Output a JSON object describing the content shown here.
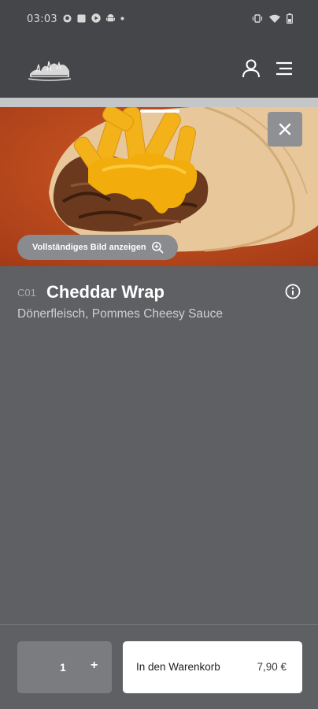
{
  "status_bar": {
    "time": "03:03",
    "left_icons": [
      "github-icon",
      "square-icon",
      "play-icon",
      "android-icon",
      "dot-icon"
    ],
    "right_icons": [
      "vibrate-icon",
      "wifi-icon",
      "battery-icon"
    ]
  },
  "header": {
    "logo": "restaurant-logo",
    "icons": [
      "user-icon",
      "menu-icon"
    ]
  },
  "hero": {
    "full_image_label": "Vollständiges Bild anzeigen"
  },
  "product": {
    "code": "C01",
    "name": "Cheddar Wrap",
    "description": "Dönerfleisch, Pommes Cheesy Sauce"
  },
  "order": {
    "quantity": "1",
    "plus": "+",
    "add_to_cart_label": "In den Warenkorb",
    "price": "7,90 €"
  },
  "colors": {
    "background": "#5f6064",
    "header": "#454649",
    "accent_orange": "#c4511f",
    "cheese": "#f0b514"
  }
}
